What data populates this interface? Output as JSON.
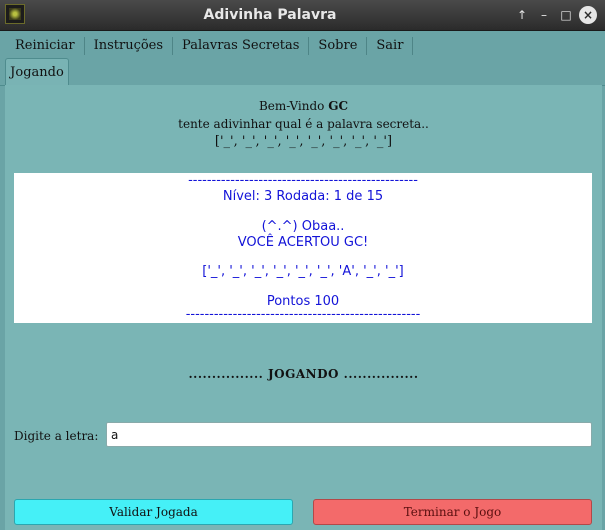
{
  "window": {
    "title": "Adivinha Palavra",
    "controls": [
      "↑",
      "–",
      "□",
      "×"
    ]
  },
  "menu": {
    "items": [
      "Reiniciar",
      "Instruções",
      "Palavras Secretas",
      "Sobre",
      "Sair"
    ]
  },
  "tabs": {
    "active": "Jogando"
  },
  "welcome": {
    "greeting": "Bem-Vindo",
    "player": "GC",
    "instruction": "tente adivinhar qual é a palavra secreta..",
    "mask": "['_', '_', '_', '_', '_', '_', '_', '_']"
  },
  "result": {
    "divider_top": "-------------------------------------------------",
    "level_line": "Nível: 3 Rodada: 1 de 15",
    "emote": "(^.^) Obaa..",
    "message": "VOCÊ ACERTOU GC!",
    "mask": "['_', '_', '_', '_', '_', '_', 'A', '_', '_']",
    "points": "Pontos 100",
    "divider_bottom": "--------------------------------------------------"
  },
  "status": {
    "text": "................ JOGANDO ................"
  },
  "input": {
    "label": "Digite a letra:",
    "value": "a"
  },
  "buttons": {
    "validate": "Validar Jogada",
    "end": "Terminar o Jogo"
  },
  "colors": {
    "background": "#6aa4a6",
    "result_text": "#1313d8",
    "validate_button": "#45f0f7",
    "end_button": "#f36a6a"
  }
}
